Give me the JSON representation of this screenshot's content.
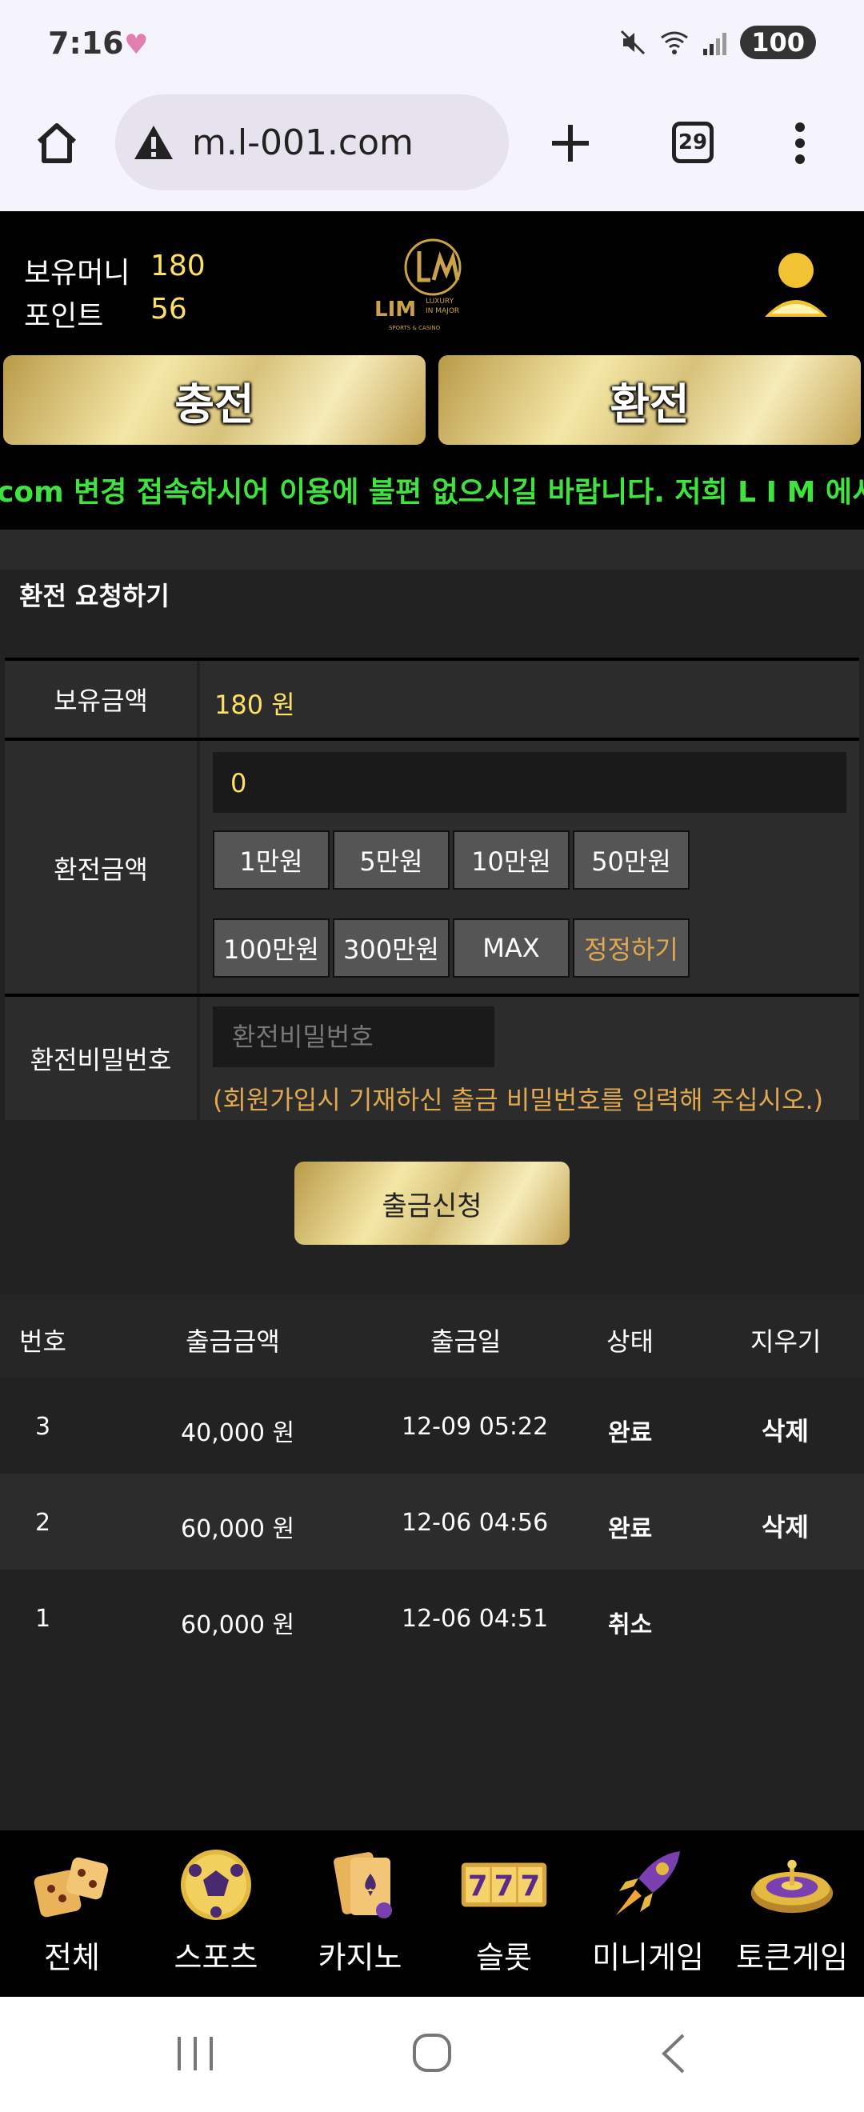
{
  "status_bar": {
    "time": "7:16",
    "battery": "100"
  },
  "browser": {
    "url": "m.l-001.com",
    "tab_count": "29"
  },
  "header": {
    "money_label": "보유머니",
    "money_value": "180",
    "points_label": "포인트",
    "points_value": "56",
    "logo_text": "LIM",
    "logo_sub1": "LUXURY",
    "logo_sub2": "IN MAJOR",
    "logo_sub3": "SPORTS & CASINO"
  },
  "actions": {
    "deposit_label": "충전",
    "withdraw_label": "환전"
  },
  "marquee": {
    "text": "com 변경 접속하시어 이용에 불편 없으시길 바랍니다. 저희 L I M 에서는 항"
  },
  "form": {
    "title": "환전 요청하기",
    "balance_label": "보유금액",
    "balance_value": "180 원",
    "amount_label": "환전금액",
    "amount_value": "0",
    "amount_buttons": [
      "1만원",
      "5만원",
      "10만원",
      "50만원",
      "100만원",
      "300만원",
      "MAX",
      "정정하기"
    ],
    "password_label": "환전비밀번호",
    "password_placeholder": "환전비밀번호",
    "password_note": "(회원가입시 기재하신 출금 비밀번호를 입력해 주십시오.)",
    "submit_label": "출금신청"
  },
  "history": {
    "headers": [
      "번호",
      "출금금액",
      "출금일",
      "상태",
      "지우기"
    ],
    "rows": [
      {
        "no": "3",
        "amount": "40,000 원",
        "date": "12-09 05:22",
        "status": "완료",
        "delete": "삭제"
      },
      {
        "no": "2",
        "amount": "60,000 원",
        "date": "12-06 04:56",
        "status": "완료",
        "delete": "삭제"
      },
      {
        "no": "1",
        "amount": "60,000 원",
        "date": "12-06 04:51",
        "status": "취소",
        "delete": ""
      }
    ]
  },
  "bottom_nav": [
    {
      "label": "전체",
      "icon": "dice-icon"
    },
    {
      "label": "스포츠",
      "icon": "soccer-ball-icon"
    },
    {
      "label": "카지노",
      "icon": "cards-icon"
    },
    {
      "label": "슬롯",
      "icon": "slot-777-icon"
    },
    {
      "label": "미니게임",
      "icon": "rocket-icon"
    },
    {
      "label": "토큰게임",
      "icon": "roulette-icon"
    }
  ],
  "colors": {
    "gold": "#e8d48a",
    "highlight_yellow": "#ffe066",
    "marquee_green": "#3ee33e",
    "note_orange": "#e0a950"
  }
}
